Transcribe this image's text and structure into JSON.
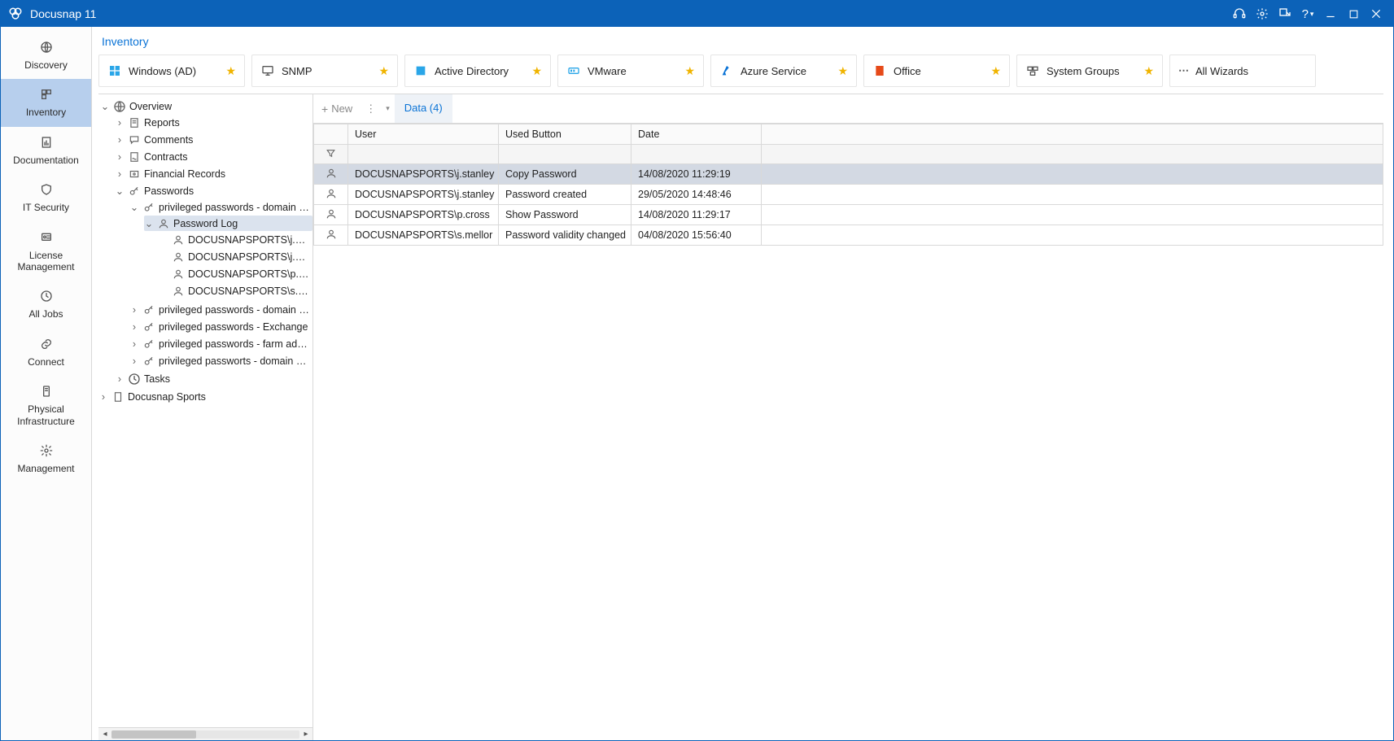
{
  "app": {
    "title": "Docusnap 11"
  },
  "nav": [
    {
      "id": "discovery",
      "label": "Discovery",
      "icon": "globe"
    },
    {
      "id": "inventory",
      "label": "Inventory",
      "icon": "inventory",
      "selected": true
    },
    {
      "id": "documentation",
      "label": "Documentation",
      "icon": "doc-bar"
    },
    {
      "id": "it-security",
      "label": "IT Security",
      "icon": "shield"
    },
    {
      "id": "license",
      "label": "License Management",
      "icon": "license"
    },
    {
      "id": "all-jobs",
      "label": "All Jobs",
      "icon": "clock"
    },
    {
      "id": "connect",
      "label": "Connect",
      "icon": "link"
    },
    {
      "id": "physical",
      "label": "Physical Infrastructure",
      "icon": "server"
    },
    {
      "id": "management",
      "label": "Management",
      "icon": "gear"
    }
  ],
  "section_title": "Inventory",
  "tiles": [
    {
      "id": "windows-ad",
      "label": "Windows (AD)",
      "icon": "windows",
      "star": true
    },
    {
      "id": "snmp",
      "label": "SNMP",
      "icon": "monitor",
      "star": true
    },
    {
      "id": "active-directory",
      "label": "Active Directory",
      "icon": "ad",
      "star": true
    },
    {
      "id": "vmware",
      "label": "VMware",
      "icon": "vmware",
      "star": true
    },
    {
      "id": "azure",
      "label": "Azure Service",
      "icon": "azure",
      "star": true
    },
    {
      "id": "office",
      "label": "Office",
      "icon": "office",
      "star": true
    },
    {
      "id": "system-groups",
      "label": "System Groups",
      "icon": "groups",
      "star": true
    },
    {
      "id": "all-wizards",
      "label": "All Wizards",
      "icon": "dots",
      "star": false
    }
  ],
  "tree": {
    "root": "Overview",
    "items": [
      {
        "label": "Reports",
        "icon": "report",
        "depth": 1
      },
      {
        "label": "Comments",
        "icon": "comment",
        "depth": 1
      },
      {
        "label": "Contracts",
        "icon": "contract",
        "depth": 1
      },
      {
        "label": "Financial Records",
        "icon": "financial",
        "depth": 1
      },
      {
        "label": "Passwords",
        "icon": "key",
        "depth": 1,
        "expanded": true
      },
      {
        "label": "privileged passwords - domain adm",
        "icon": "key",
        "depth": 2,
        "expanded": true
      },
      {
        "label": "Password Log",
        "icon": "user",
        "depth": 3,
        "selected": true,
        "expanded": true
      },
      {
        "label": "DOCUSNAPSPORTS\\j.stanley",
        "icon": "user",
        "depth": 4
      },
      {
        "label": "DOCUSNAPSPORTS\\j.stanley",
        "icon": "user",
        "depth": 4
      },
      {
        "label": "DOCUSNAPSPORTS\\p.cross",
        "icon": "user",
        "depth": 4
      },
      {
        "label": "DOCUSNAPSPORTS\\s.mellor",
        "icon": "user",
        "depth": 4
      },
      {
        "label": "privileged passwords - domain adm",
        "icon": "key",
        "depth": 2
      },
      {
        "label": "privileged passwords - Exchange",
        "icon": "key",
        "depth": 2
      },
      {
        "label": "privileged passwords - farm adminis",
        "icon": "key",
        "depth": 2
      },
      {
        "label": "privileged passworts - domain admi",
        "icon": "key",
        "depth": 2
      },
      {
        "label": "Tasks",
        "icon": "clock",
        "depth": 1
      },
      {
        "label": "Docusnap Sports",
        "icon": "building",
        "depth": 0,
        "root2": true
      }
    ]
  },
  "toolbar": {
    "new_label": "New",
    "tab_label": "Data (4)"
  },
  "columns": [
    "",
    "User",
    "Used Button",
    "Date",
    ""
  ],
  "col_widths": [
    "42px",
    "185px",
    "163px",
    "160px",
    "auto"
  ],
  "rows": [
    {
      "user": "DOCUSNAPSPORTS\\j.stanley",
      "button": "Copy Password",
      "date": "14/08/2020 11:29:19",
      "selected": true
    },
    {
      "user": "DOCUSNAPSPORTS\\j.stanley",
      "button": "Password created",
      "date": "29/05/2020 14:48:46"
    },
    {
      "user": "DOCUSNAPSPORTS\\p.cross",
      "button": "Show Password",
      "date": "14/08/2020 11:29:17"
    },
    {
      "user": "DOCUSNAPSPORTS\\s.mellor",
      "button": "Password validity changed",
      "date": "04/08/2020 15:56:40"
    }
  ]
}
